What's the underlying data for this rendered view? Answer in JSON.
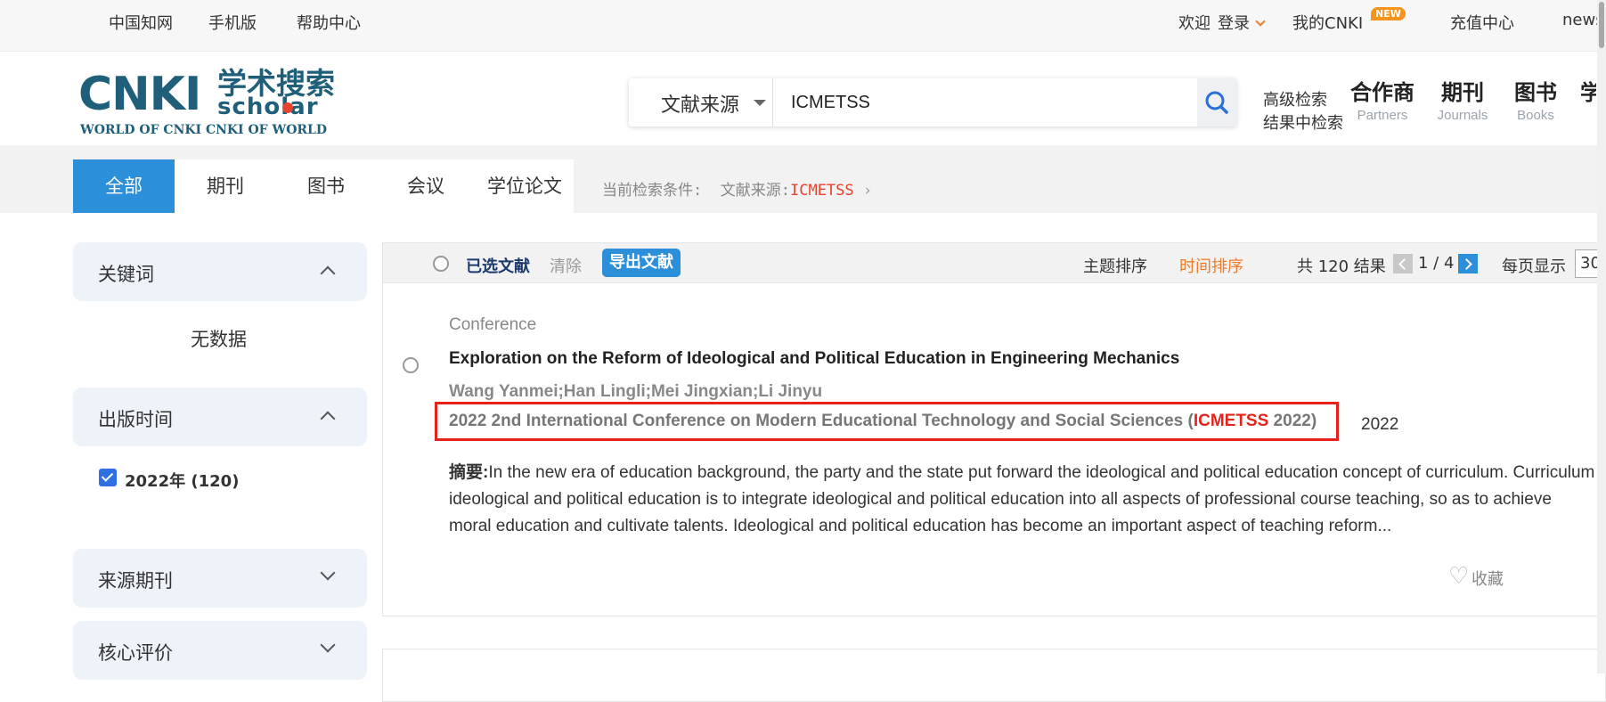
{
  "topbar": {
    "links": [
      "中国知网",
      "手机版",
      "帮助中心"
    ],
    "welcome": "欢迎",
    "login": "登录",
    "my_cnki": "我的CNKI",
    "new_badge": "NEW",
    "recharge": "充值中心",
    "news": "news"
  },
  "logo": {
    "mark": "CNKI",
    "cn_title": "学术搜索",
    "sub": "scholar",
    "tagline": "WORLD OF CNKI CNKI OF WORLD"
  },
  "search": {
    "field": "文献来源",
    "query": "ICMETSS",
    "advanced": "高级检索",
    "in_results": "结果中检索"
  },
  "nav": [
    {
      "cn": "合作商",
      "en": "Partners"
    },
    {
      "cn": "期刊",
      "en": "Journals"
    },
    {
      "cn": "图书",
      "en": "Books"
    },
    {
      "cn": "学",
      "en": ""
    }
  ],
  "tabs": [
    "全部",
    "期刊",
    "图书",
    "会议",
    "学位论文"
  ],
  "criteria": {
    "label": "当前检索条件:",
    "field": "文献来源:",
    "value": "ICMETSS"
  },
  "sidebar": {
    "keywords": {
      "title": "关键词",
      "empty": "无数据"
    },
    "pubtime": {
      "title": "出版时间",
      "option": "2022年",
      "count": "(120)"
    },
    "source": {
      "title": "来源期刊"
    },
    "core": {
      "title": "核心评价"
    }
  },
  "results_bar": {
    "selected": "已选文献",
    "clear": "清除",
    "export": "导出文献",
    "sort_topic": "主题排序",
    "sort_time": "时间排序",
    "total": "共 120 结果",
    "page": "1 / 4",
    "per_page_label": "每页显示",
    "per_page_value": "30"
  },
  "result": {
    "type": "Conference",
    "title": "Exploration on the Reform of Ideological and Political Education in Engineering Mechanics",
    "authors": "Wang Yanmei;Han Lingli;Mei Jingxian;Li Jinyu",
    "source_prefix": "2022 2nd International Conference on Modern Educational Technology and Social Sciences (",
    "source_highlight": "ICMETSS",
    "source_suffix": " 2022)",
    "year": "2022",
    "abstract_label": "摘要:",
    "abstract": "In the new era of education background, the party and the state put forward the ideological and political education concept of curriculum. Curriculum ideological and political education is to integrate ideological and political education into all aspects of professional course teaching, so as to achieve moral education and cultivate talents. Ideological and political education has become an important aspect of teaching reform...",
    "favorite": "收藏"
  },
  "colors": {
    "accent": "#2b8fd9",
    "highlight": "#e5231b",
    "sort_active": "#f07b2a",
    "brand": "#1f5f7a"
  }
}
